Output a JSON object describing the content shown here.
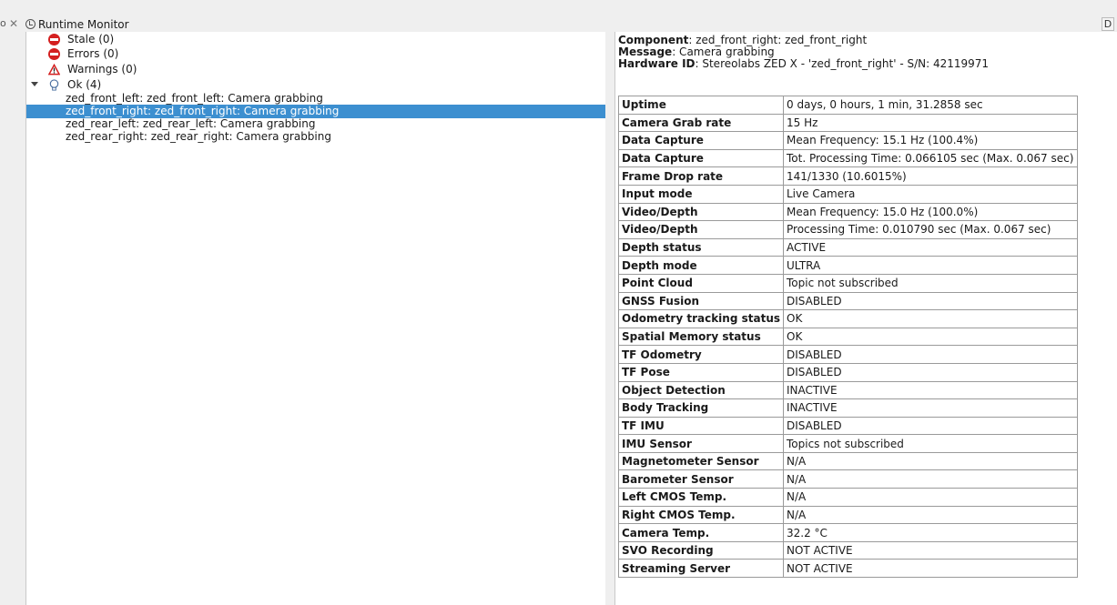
{
  "window": {
    "tab_title": "Runtime Monitor",
    "close_glyph": "✕",
    "left_glyph": "o",
    "right_button": "D"
  },
  "tree": {
    "stale": "Stale (0)",
    "errors": "Errors (0)",
    "warnings": "Warnings (0)",
    "ok": "Ok (4)",
    "items": [
      "zed_front_left: zed_front_left: Camera grabbing",
      "zed_front_right: zed_front_right: Camera grabbing",
      "zed_rear_left: zed_rear_left: Camera grabbing",
      "zed_rear_right: zed_rear_right: Camera grabbing"
    ],
    "selected_index": 1
  },
  "details": {
    "component_label": "Component",
    "component_value": ": zed_front_right: zed_front_right",
    "message_label": "Message",
    "message_value": ": Camera grabbing",
    "hardware_label": "Hardware ID",
    "hardware_value": ": Stereolabs ZED X - 'zed_front_right' - S/N: 42119971"
  },
  "stats": [
    {
      "key": "Uptime",
      "value": "0 days, 0 hours, 1 min, 31.2858 sec"
    },
    {
      "key": "Camera Grab rate",
      "value": "15 Hz"
    },
    {
      "key": "Data Capture",
      "value": "Mean Frequency: 15.1 Hz (100.4%)"
    },
    {
      "key": "Data Capture",
      "value": "Tot. Processing Time: 0.066105 sec (Max. 0.067 sec)"
    },
    {
      "key": "Frame Drop rate",
      "value": "141/1330 (10.6015%)"
    },
    {
      "key": "Input mode",
      "value": "Live Camera"
    },
    {
      "key": "Video/Depth",
      "value": "Mean Frequency: 15.0 Hz (100.0%)"
    },
    {
      "key": "Video/Depth",
      "value": "Processing Time: 0.010790 sec (Max. 0.067 sec)"
    },
    {
      "key": "Depth status",
      "value": "ACTIVE"
    },
    {
      "key": "Depth mode",
      "value": "ULTRA"
    },
    {
      "key": "Point Cloud",
      "value": "Topic not subscribed"
    },
    {
      "key": "GNSS Fusion",
      "value": "DISABLED"
    },
    {
      "key": "Odometry tracking status",
      "value": "OK"
    },
    {
      "key": "Spatial Memory status",
      "value": "OK"
    },
    {
      "key": "TF Odometry",
      "value": "DISABLED"
    },
    {
      "key": "TF Pose",
      "value": "DISABLED"
    },
    {
      "key": "Object Detection",
      "value": "INACTIVE"
    },
    {
      "key": "Body Tracking",
      "value": "INACTIVE"
    },
    {
      "key": "TF IMU",
      "value": "DISABLED"
    },
    {
      "key": "IMU Sensor",
      "value": "Topics not subscribed"
    },
    {
      "key": "Magnetometer Sensor",
      "value": "N/A"
    },
    {
      "key": "Barometer Sensor",
      "value": "N/A"
    },
    {
      "key": "Left CMOS Temp.",
      "value": "N/A"
    },
    {
      "key": "Right CMOS Temp.",
      "value": "N/A"
    },
    {
      "key": "Camera Temp.",
      "value": "32.2 °C"
    },
    {
      "key": "SVO Recording",
      "value": "NOT ACTIVE"
    },
    {
      "key": "Streaming Server",
      "value": "NOT ACTIVE"
    }
  ],
  "colors": {
    "selection": "#3c8fd0",
    "error_red": "#d41f1f"
  }
}
